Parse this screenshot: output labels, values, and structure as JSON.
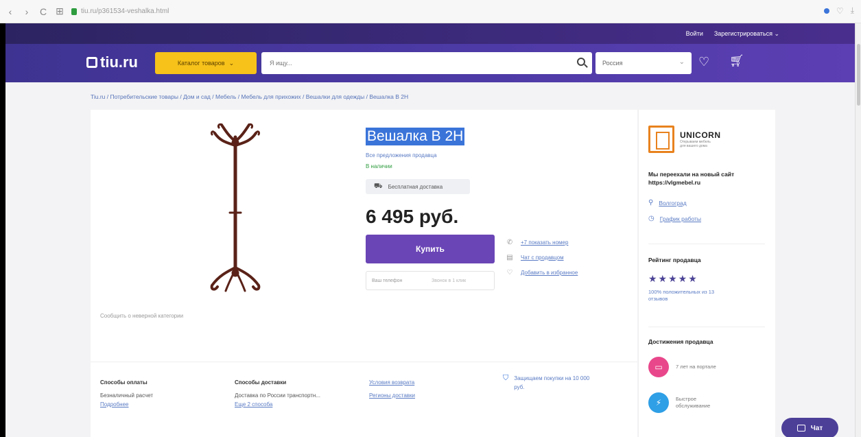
{
  "browser": {
    "url": "tiu.ru/p361534-veshalka.html",
    "back": "‹",
    "forward": "›",
    "reload": "C",
    "apps": "⊞"
  },
  "topline": {
    "login": "Войти",
    "register": "Зарегистрироваться ⌄"
  },
  "header": {
    "logo": "tiu.ru",
    "catalog_label": "Каталог товаров",
    "search_placeholder": "Я ищу...",
    "region_label": "Россия"
  },
  "breadcrumb": "Tiu.ru / Потребительские товары / Дом и сад / Мебель / Мебель для прихожих / Вешалки для одежды / Вешалка В 2Н",
  "product": {
    "title": "Вешалка В 2Н",
    "all_offers": "Все предложения продавца",
    "availability": "В наличии",
    "free_delivery": "Бесплатная доставка",
    "price": "6 495 руб.",
    "buy_label": "Купить",
    "phone_placeholder": "Ваш телефон",
    "callback_label": "Звонок в 1 клик",
    "report_link": "Сообщить о неверной категории"
  },
  "contacts": [
    {
      "icon": "phone-icon",
      "glyph": "✆",
      "label": "+7 показать номер"
    },
    {
      "icon": "chat-icon",
      "glyph": "▤",
      "label": "Чат с продавцом"
    },
    {
      "icon": "heart-icon",
      "glyph": "♡",
      "label": "Добавить в избранное"
    }
  ],
  "info": {
    "payment_title": "Способы оплаты",
    "payment_text": "Безналичный расчет",
    "payment_link": "Подробнее",
    "delivery_title": "Способы доставки",
    "delivery_text": "Доставка по России транспортн...",
    "delivery_link": "Еще 2 способа",
    "return_link": "Условия возврата",
    "regions_link": "Регионы доставки",
    "protection_text": "Защищаем покупки на 10 000 руб."
  },
  "seller": {
    "name": "UNICORN",
    "tagline": "Открываем мебель для вашего дома",
    "note": "Мы переехали на новый сайт https://vlgmebel.ru",
    "city": "Волгоград",
    "schedule": "График работы",
    "rating_title": "Рейтинг продавца",
    "stars": "★★★★★",
    "rating_text": "100% положительных из 13 отзывов",
    "achievements_title": "Достижения продавца",
    "achv1_text": "7 лет на портале",
    "achv2_text": "Быстрое обслуживание"
  },
  "chat_label": "Чат",
  "colors": {
    "header": "#4d3aa6",
    "catalog": "#f7c21a",
    "buy": "#6a45b6",
    "link": "#5a7bc4",
    "achv1": "#e9478b",
    "achv2": "#2f9fe6"
  }
}
